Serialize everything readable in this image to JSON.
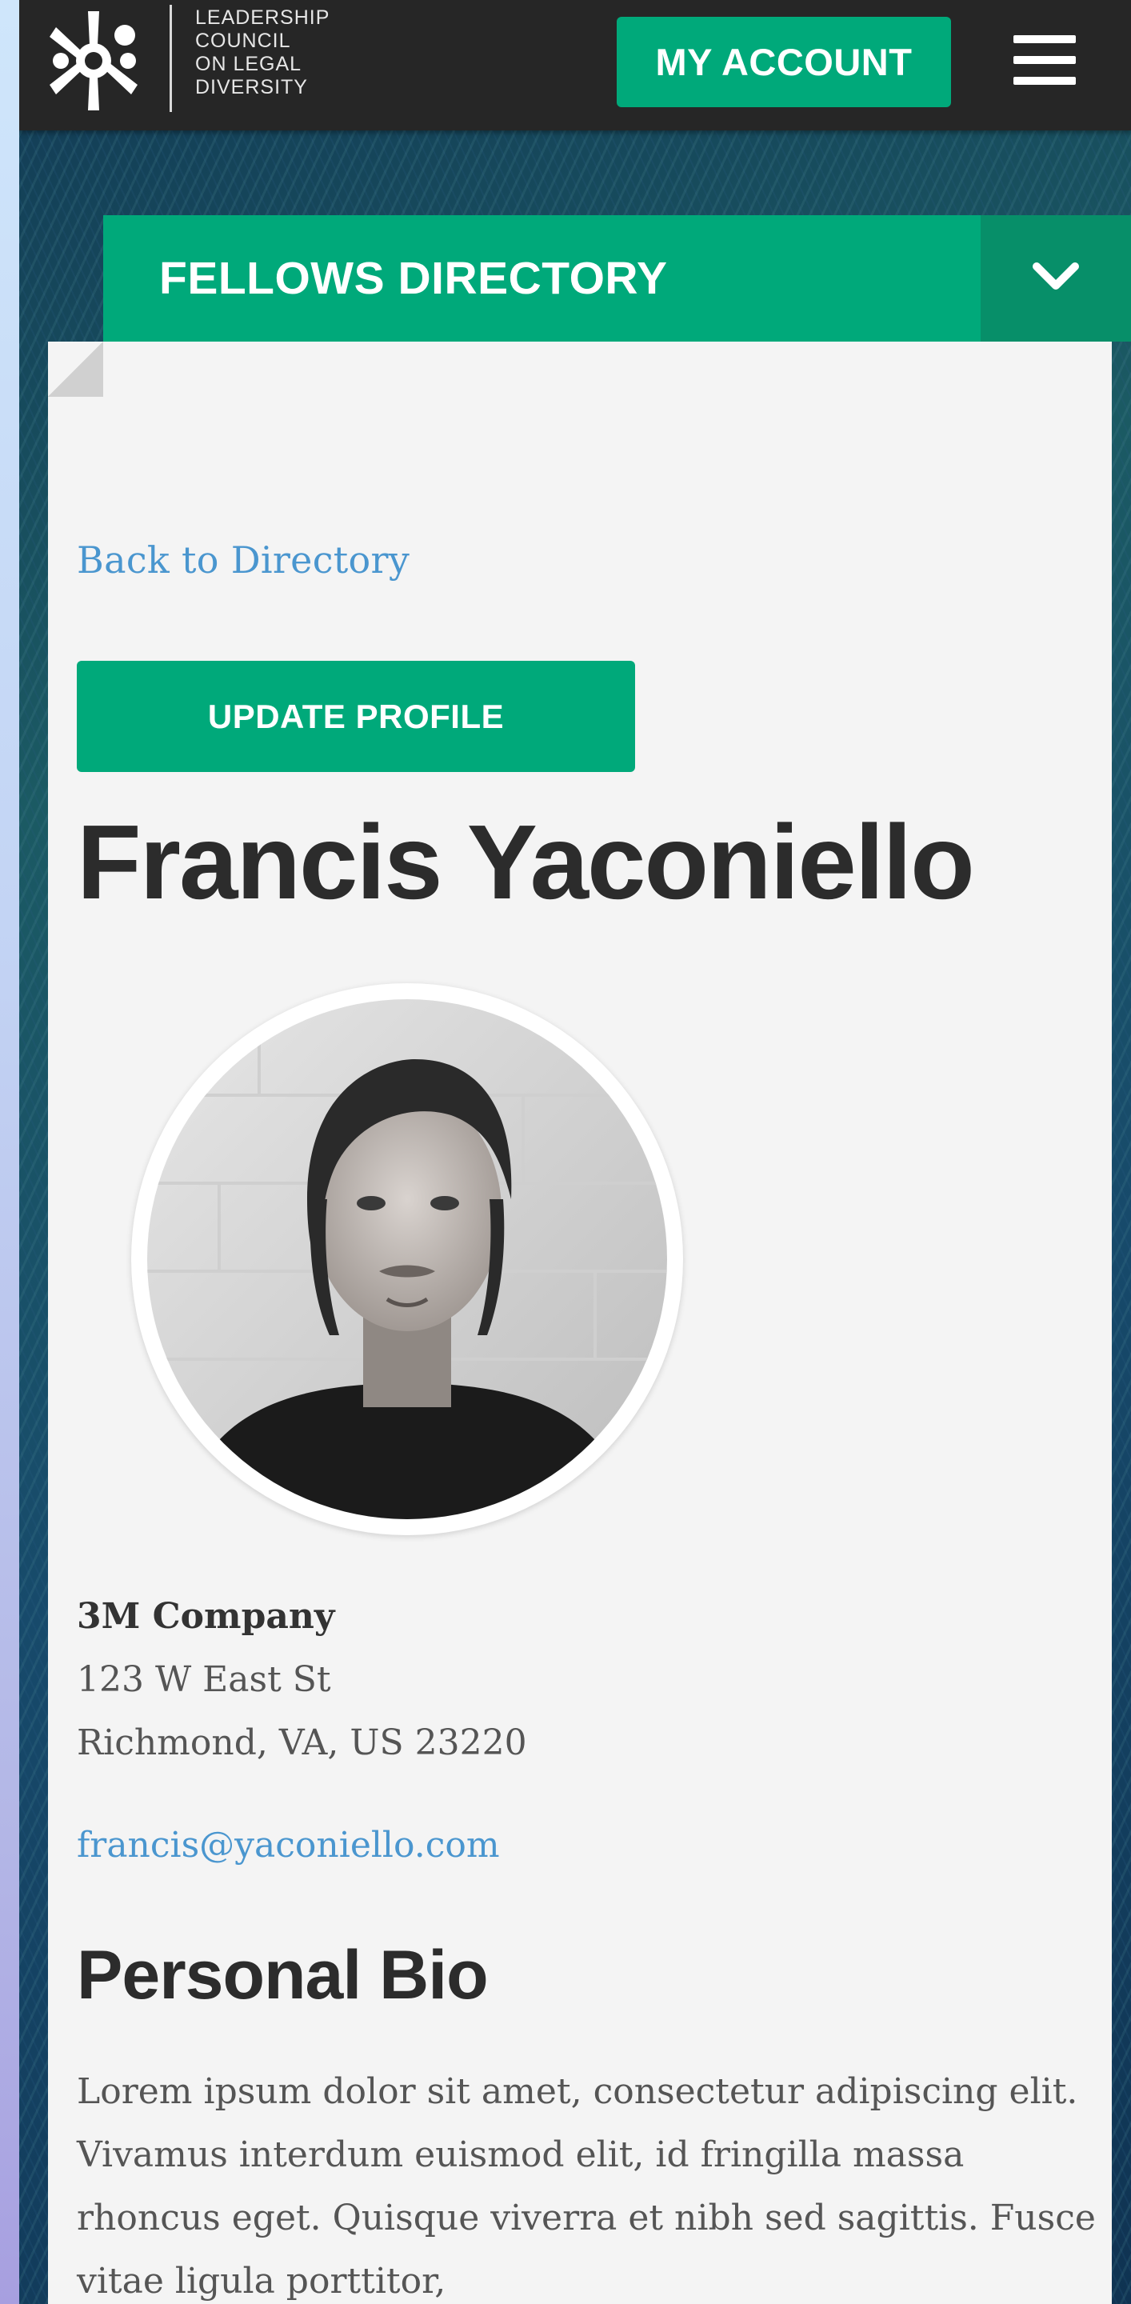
{
  "header": {
    "logo_lines": [
      "LEADERSHIP",
      "COUNCIL",
      "ON LEGAL",
      "DIVERSITY"
    ],
    "account_button": "MY ACCOUNT",
    "menu_icon": "hamburger-menu-icon"
  },
  "directory": {
    "title": "FELLOWS DIRECTORY",
    "toggle_icon": "chevron-down-icon"
  },
  "profile": {
    "back_link": "Back to Directory",
    "update_button": "UPDATE PROFILE",
    "name": "Francis Yaconiello",
    "company": "3M Company",
    "address_line1": "123 W East St",
    "address_line2": "Richmond, VA, US 23220",
    "email": "francis@yaconiello.com",
    "bio_heading": "Personal Bio",
    "bio_text": "Lorem ipsum dolor sit amet, consectetur adipiscing elit. Vivamus interdum euismod elit, id fringilla massa rhoncus eget. Quisque viverra et nibh sed sagittis. Fusce vitae ligula porttitor,"
  },
  "colors": {
    "accent": "#00a97a",
    "accent_dark": "#078f69",
    "header_bg": "#262626",
    "link": "#4a96cf",
    "card_bg": "#f4f4f4"
  }
}
